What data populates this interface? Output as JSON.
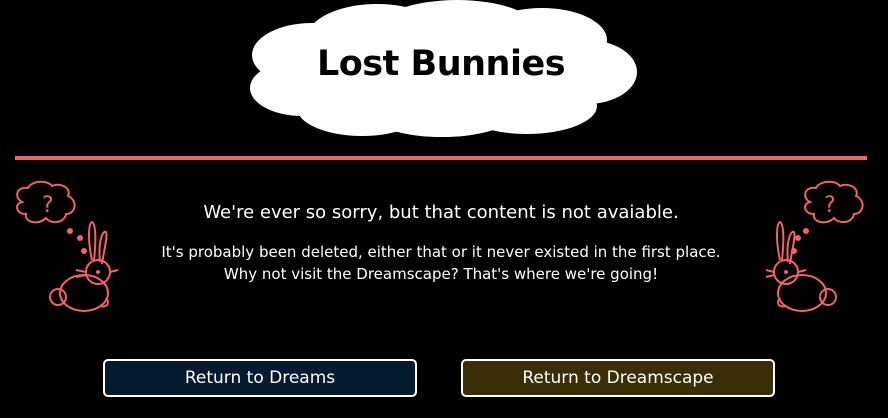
{
  "header": {
    "title": "Lost Bunnies"
  },
  "message": {
    "heading": "We're ever so sorry, but that content is not avaiable.",
    "line1": "It's probably been deleted, either that or it never existed in the first place.",
    "line2": "Why not visit the Dreamscape? That's where we're going!"
  },
  "buttons": {
    "dreams_label": "Return to Dreams",
    "dreamscape_label": "Return to Dreamscape"
  },
  "illustrations": {
    "left": "confused-bunny-icon",
    "right": "confused-bunny-icon",
    "thought_mark": "?"
  },
  "colors": {
    "background": "#000000",
    "accent": "#f26363",
    "dreams_button": "#061a30",
    "dreamscape_button": "#3a2e06"
  }
}
